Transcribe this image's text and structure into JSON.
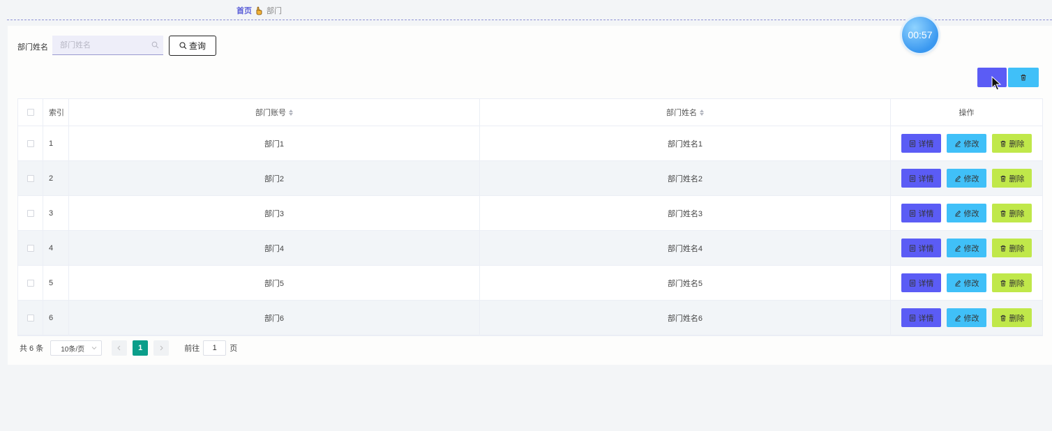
{
  "breadcrumb": {
    "home": "首页",
    "current": "部门"
  },
  "search": {
    "label": "部门姓名",
    "placeholder": "部门姓名",
    "value": "",
    "button_label": "查询"
  },
  "timer": {
    "text": "00:57"
  },
  "table": {
    "headers": {
      "index": "索引",
      "account": "部门账号",
      "name": "部门姓名",
      "ops": "操作"
    },
    "rows": [
      {
        "index": "1",
        "account": "部门1",
        "name": "部门姓名1"
      },
      {
        "index": "2",
        "account": "部门2",
        "name": "部门姓名2"
      },
      {
        "index": "3",
        "account": "部门3",
        "name": "部门姓名3"
      },
      {
        "index": "4",
        "account": "部门4",
        "name": "部门姓名4"
      },
      {
        "index": "5",
        "account": "部门5",
        "name": "部门姓名5"
      },
      {
        "index": "6",
        "account": "部门6",
        "name": "部门姓名6"
      }
    ],
    "actions": {
      "detail": "详情",
      "edit": "修改",
      "delete": "删除"
    }
  },
  "pagination": {
    "total": "共 6 条",
    "page_size": "10条/页",
    "current_page": "1",
    "goto_label": "前往",
    "goto_value": "1",
    "page_suffix": "页"
  },
  "colors": {
    "primary": "#5b5cf5",
    "info": "#40c0f8",
    "warning": "#c0e84a",
    "pager_active": "#0b9e8a"
  },
  "icons": {
    "search_input": "search-icon",
    "query": "search-icon",
    "batch_delete": "trash-icon",
    "detail": "document-icon",
    "edit": "pencil-icon",
    "delete": "trash-icon"
  }
}
